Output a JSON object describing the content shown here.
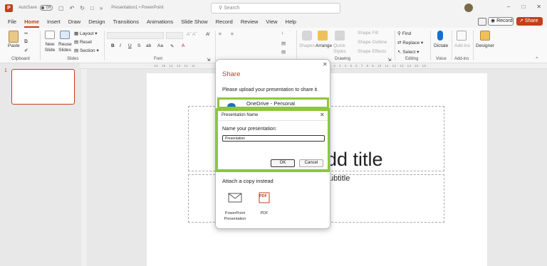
{
  "titlebar": {
    "autosave_label": "AutoSave",
    "autosave_state": "Off",
    "doc_title": "Presentation1 • PowerPoint",
    "search_placeholder": "Search",
    "win_min": "−",
    "win_max": "□",
    "win_close": "✕"
  },
  "menu": {
    "tabs": [
      "File",
      "Home",
      "Insert",
      "Draw",
      "Design",
      "Transitions",
      "Animations",
      "Slide Show",
      "Record",
      "Review",
      "View",
      "Help"
    ],
    "active": "Home",
    "record_label": "Record",
    "share_label": "Share"
  },
  "ribbon": {
    "clipboard": {
      "paste": "Paste",
      "label": "Clipboard"
    },
    "slides": {
      "new_slide": "New Slide",
      "reuse_slides": "Reuse Slides",
      "layout": "Layout",
      "reset": "Reset",
      "section": "Section",
      "label": "Slides"
    },
    "font": {
      "label": "Font",
      "bold": "B",
      "italic": "I",
      "underline": "U",
      "strike": "S",
      "spacing": "ab",
      "case": "Aa"
    },
    "paragraph": {
      "label": "Paragraph"
    },
    "drawing": {
      "shapes": "Shapes",
      "arrange": "Arrange",
      "quick_styles": "Quick Styles",
      "shape_fill": "Shape Fill",
      "shape_outline": "Shape Outline",
      "shape_effects": "Shape Effects",
      "label": "Drawing"
    },
    "editing": {
      "find": "Find",
      "replace": "Replace",
      "select": "Select",
      "label": "Editing"
    },
    "voice": {
      "dictate": "Dictate",
      "label": "Voice"
    },
    "addins": {
      "addins": "Add-ins",
      "label": "Add-ins"
    },
    "designer": {
      "designer": "Designer"
    }
  },
  "ruler": {
    "left_ticks": "· 16 · 15 · 14 · 13 · 12 · 11 ·",
    "right_ticks": "· 2 · 3 · 4 · 5 · 6 · 7 · 8 · 9 · 10 · 11 · 12 · 13 · 14 · 15 · 16 ·"
  },
  "thumbnails": {
    "slide_number": "1"
  },
  "slide": {
    "title_placeholder": "dd title",
    "subtitle_placeholder": "ubtitle"
  },
  "share_pane": {
    "title": "Share",
    "message": "Please upload your presentation to share it.",
    "onedrive_label": "OneDrive - Personal",
    "attach_title": "Attach a copy instead",
    "attach_pptx": "PowerPoint Presentation",
    "attach_pdf": "PDF",
    "pdf_icon_text": "PDF"
  },
  "name_dialog": {
    "title": "Presentation Name",
    "prompt": "Name your presentation:",
    "input_value": "Presentation",
    "ok": "OK",
    "cancel": "Cancel"
  },
  "colors": {
    "accent": "#c43e1c",
    "highlight": "#8dc63f",
    "onedrive": "#1a6fc9"
  }
}
